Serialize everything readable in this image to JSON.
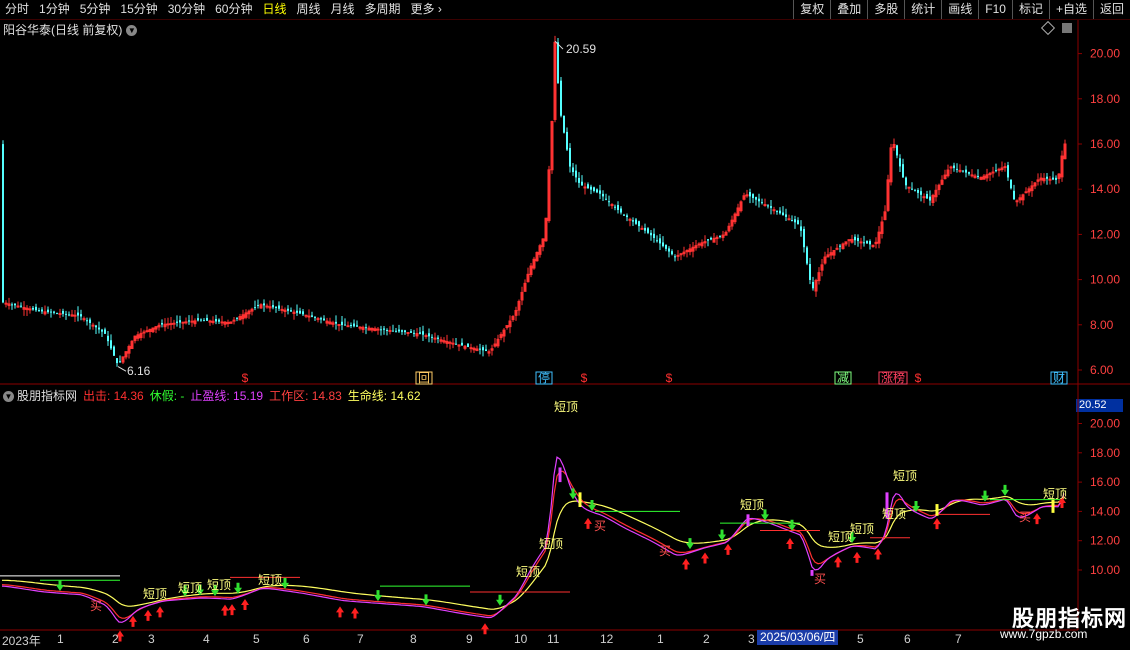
{
  "toolbar": {
    "periods": [
      "分时",
      "1分钟",
      "5分钟",
      "15分钟",
      "30分钟",
      "60分钟",
      "日线",
      "周线",
      "月线",
      "多周期"
    ],
    "active_period": "日线",
    "more_label": "更多",
    "right_buttons": [
      "复权",
      "叠加",
      "多股",
      "统计",
      "画线",
      "F10",
      "标记",
      "+自选",
      "返回"
    ]
  },
  "main_panel": {
    "title": "阳谷华泰(日线 前复权)",
    "high_label": "20.59",
    "low_label": "6.16",
    "y_ticks": [
      "20.00",
      "18.00",
      "16.00",
      "14.00",
      "12.00",
      "10.00",
      "8.00",
      "6.00"
    ],
    "event_markers": [
      {
        "text": "$",
        "color": "#ff3030",
        "x": 245
      },
      {
        "text": "回",
        "color": "#ffcc66",
        "x": 424
      },
      {
        "text": "停",
        "color": "#40c0ff",
        "x": 544
      },
      {
        "text": "$",
        "color": "#ff3030",
        "x": 584
      },
      {
        "text": "$",
        "color": "#ff3030",
        "x": 669
      },
      {
        "text": "减",
        "color": "#80ff80",
        "x": 843
      },
      {
        "text": "涨榜",
        "color": "#ff4060",
        "x": 893
      },
      {
        "text": "$",
        "color": "#ff3030",
        "x": 918
      },
      {
        "text": "财",
        "color": "#40c0ff",
        "x": 1059
      }
    ]
  },
  "indicator_panel": {
    "name": "股朋指标网",
    "labels": [
      {
        "name": "出击:",
        "value": "14.36",
        "color": "#ff3030"
      },
      {
        "name": "休假:",
        "value": "-",
        "color": "#30ff30"
      },
      {
        "name": "止盈线:",
        "value": "15.19",
        "color": "#e040ff"
      },
      {
        "name": "工作区:",
        "value": "14.83",
        "color": "#ff4040"
      },
      {
        "name": "生命线:",
        "value": "14.62",
        "color": "#ffff60"
      }
    ],
    "price_tag": "20.52",
    "y_ticks": [
      "20.00",
      "18.00",
      "16.00",
      "14.00",
      "12.00",
      "10.00"
    ],
    "texts": [
      {
        "text": "短顶",
        "x": 566,
        "y": 411,
        "color": "#ffff80"
      },
      {
        "text": "短顶",
        "x": 905,
        "y": 480,
        "color": "#ffff80"
      },
      {
        "text": "短顶",
        "x": 752,
        "y": 509,
        "color": "#ffff80"
      },
      {
        "text": "短顶",
        "x": 1055,
        "y": 498,
        "color": "#ffff80"
      },
      {
        "text": "短顶",
        "x": 840,
        "y": 541,
        "color": "#ffff80"
      },
      {
        "text": "短顶",
        "x": 862,
        "y": 533,
        "color": "#ffff80"
      },
      {
        "text": "短顶",
        "x": 894,
        "y": 518,
        "color": "#ffff80"
      },
      {
        "text": "短顶",
        "x": 551,
        "y": 548,
        "color": "#ffff80"
      },
      {
        "text": "短顶",
        "x": 528,
        "y": 576,
        "color": "#ffff80"
      },
      {
        "text": "短顶",
        "x": 270,
        "y": 584,
        "color": "#ffff80"
      },
      {
        "text": "短顶",
        "x": 219,
        "y": 589,
        "color": "#ffff80"
      },
      {
        "text": "短顶",
        "x": 190,
        "y": 592,
        "color": "#ffff80"
      },
      {
        "text": "短顶",
        "x": 155,
        "y": 598,
        "color": "#ffff80"
      },
      {
        "text": "买",
        "x": 820,
        "y": 583,
        "color": "#ff5050"
      },
      {
        "text": "买",
        "x": 96,
        "y": 610,
        "color": "#ff5050"
      },
      {
        "text": "买",
        "x": 600,
        "y": 530,
        "color": "#ff5050"
      },
      {
        "text": "买",
        "x": 665,
        "y": 555,
        "color": "#ff5050"
      },
      {
        "text": "买",
        "x": 1025,
        "y": 521,
        "color": "#ff5050"
      }
    ]
  },
  "date_axis": {
    "labels": [
      {
        "text": "2023年",
        "x": 2
      },
      {
        "text": "1",
        "x": 57
      },
      {
        "text": "2",
        "x": 112
      },
      {
        "text": "3",
        "x": 148
      },
      {
        "text": "4",
        "x": 203
      },
      {
        "text": "5",
        "x": 253
      },
      {
        "text": "6",
        "x": 303
      },
      {
        "text": "7",
        "x": 357
      },
      {
        "text": "8",
        "x": 410
      },
      {
        "text": "9",
        "x": 466
      },
      {
        "text": "10",
        "x": 514
      },
      {
        "text": "11",
        "x": 547
      },
      {
        "text": "12",
        "x": 600
      },
      {
        "text": "1",
        "x": 657
      },
      {
        "text": "2",
        "x": 703
      },
      {
        "text": "3",
        "x": 748
      },
      {
        "text": "5",
        "x": 857
      },
      {
        "text": "6",
        "x": 904
      },
      {
        "text": "7",
        "x": 955
      }
    ],
    "highlight": "2025/03/06/四"
  },
  "watermark": {
    "brand": "股朋指标网",
    "url": "www.7gpzb.com"
  }
}
